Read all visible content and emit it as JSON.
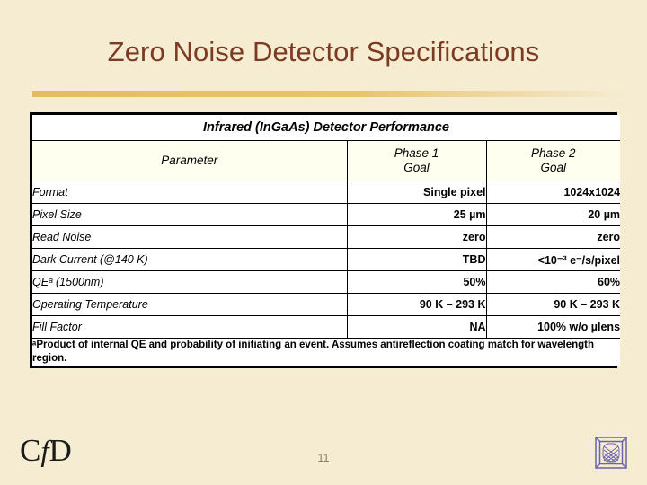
{
  "slide": {
    "title": "Zero Noise Detector Specifications",
    "page_number": "11",
    "accent_color": "#e4bc63",
    "title_color": "#7b3a21",
    "background_color": "#f5ecd2"
  },
  "table": {
    "caption": "Infrared (InGaAs) Detector Performance",
    "columns": [
      {
        "key": "parameter",
        "label": "Parameter"
      },
      {
        "key": "phase1",
        "label_line1": "Phase 1",
        "label_line2": "Goal"
      },
      {
        "key": "phase2",
        "label_line1": "Phase 2",
        "label_line2": "Goal"
      }
    ],
    "rows": [
      {
        "parameter": "Format",
        "phase1": "Single pixel",
        "phase2": "1024x1024"
      },
      {
        "parameter": "Pixel Size",
        "phase1": "25 µm",
        "phase2": "20 µm"
      },
      {
        "parameter": "Read Noise",
        "phase1": "zero",
        "phase2": "zero"
      },
      {
        "parameter": "Dark Current (@140 K)",
        "phase1": "TBD",
        "phase2": "<10⁻³ e⁻/s/pixel"
      },
      {
        "parameter": "QEᵃ (1500nm)",
        "phase1": "50%",
        "phase2": "60%"
      },
      {
        "parameter": "Operating Temperature",
        "phase1": "90 K – 293 K",
        "phase2": "90 K – 293 K"
      },
      {
        "parameter": "Fill Factor",
        "phase1": "NA",
        "phase2": "100%  w/o µlens"
      }
    ],
    "footnote": "ᵃProduct of internal QE and probability of initiating an event. Assumes antireflection coating match for wavelength region."
  },
  "footer": {
    "org_logo_text": "CfD",
    "corner_logo_color": "#6b62ad"
  }
}
